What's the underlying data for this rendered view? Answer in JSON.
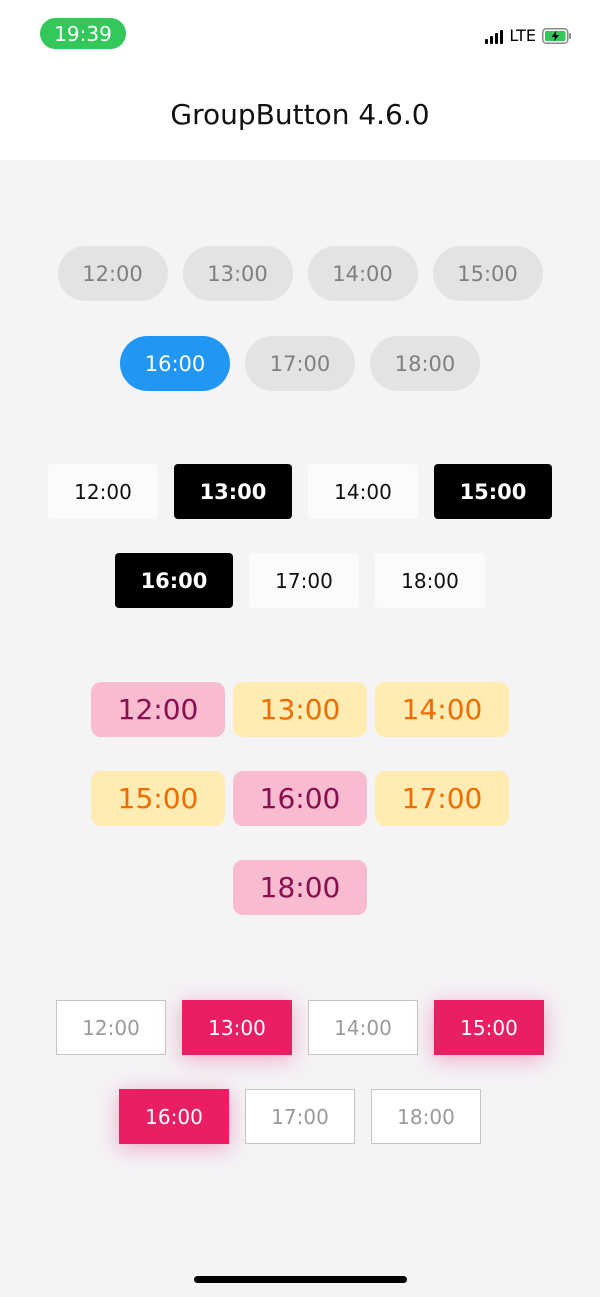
{
  "status_bar": {
    "time": "19:39",
    "network": "LTE",
    "icons": [
      "signal-icon",
      "battery-charging-icon"
    ],
    "time_pill_color": "#34c759"
  },
  "nav": {
    "title": "GroupButton 4.6.0"
  },
  "group1": {
    "style": "rounded-pill",
    "selected_color": "#2196f3",
    "buttons": [
      "12:00",
      "13:00",
      "14:00",
      "15:00",
      "16:00",
      "17:00",
      "18:00"
    ],
    "selected": [
      "16:00"
    ]
  },
  "group2": {
    "style": "square",
    "selected_color": "#000000",
    "buttons": [
      "12:00",
      "13:00",
      "14:00",
      "15:00",
      "16:00",
      "17:00",
      "18:00"
    ],
    "selected": [
      "13:00",
      "15:00",
      "16:00"
    ]
  },
  "group3": {
    "style": "rounded",
    "selected_color": "#f8bbd0",
    "unselected_color": "#ffecb3",
    "buttons": [
      "12:00",
      "13:00",
      "14:00",
      "15:00",
      "16:00",
      "17:00",
      "18:00"
    ],
    "selected": [
      "12:00",
      "16:00",
      "18:00"
    ]
  },
  "group4": {
    "style": "outlined",
    "selected_color": "#e91e63",
    "buttons": [
      "12:00",
      "13:00",
      "14:00",
      "15:00",
      "16:00",
      "17:00",
      "18:00"
    ],
    "selected": [
      "13:00",
      "15:00",
      "16:00"
    ]
  }
}
